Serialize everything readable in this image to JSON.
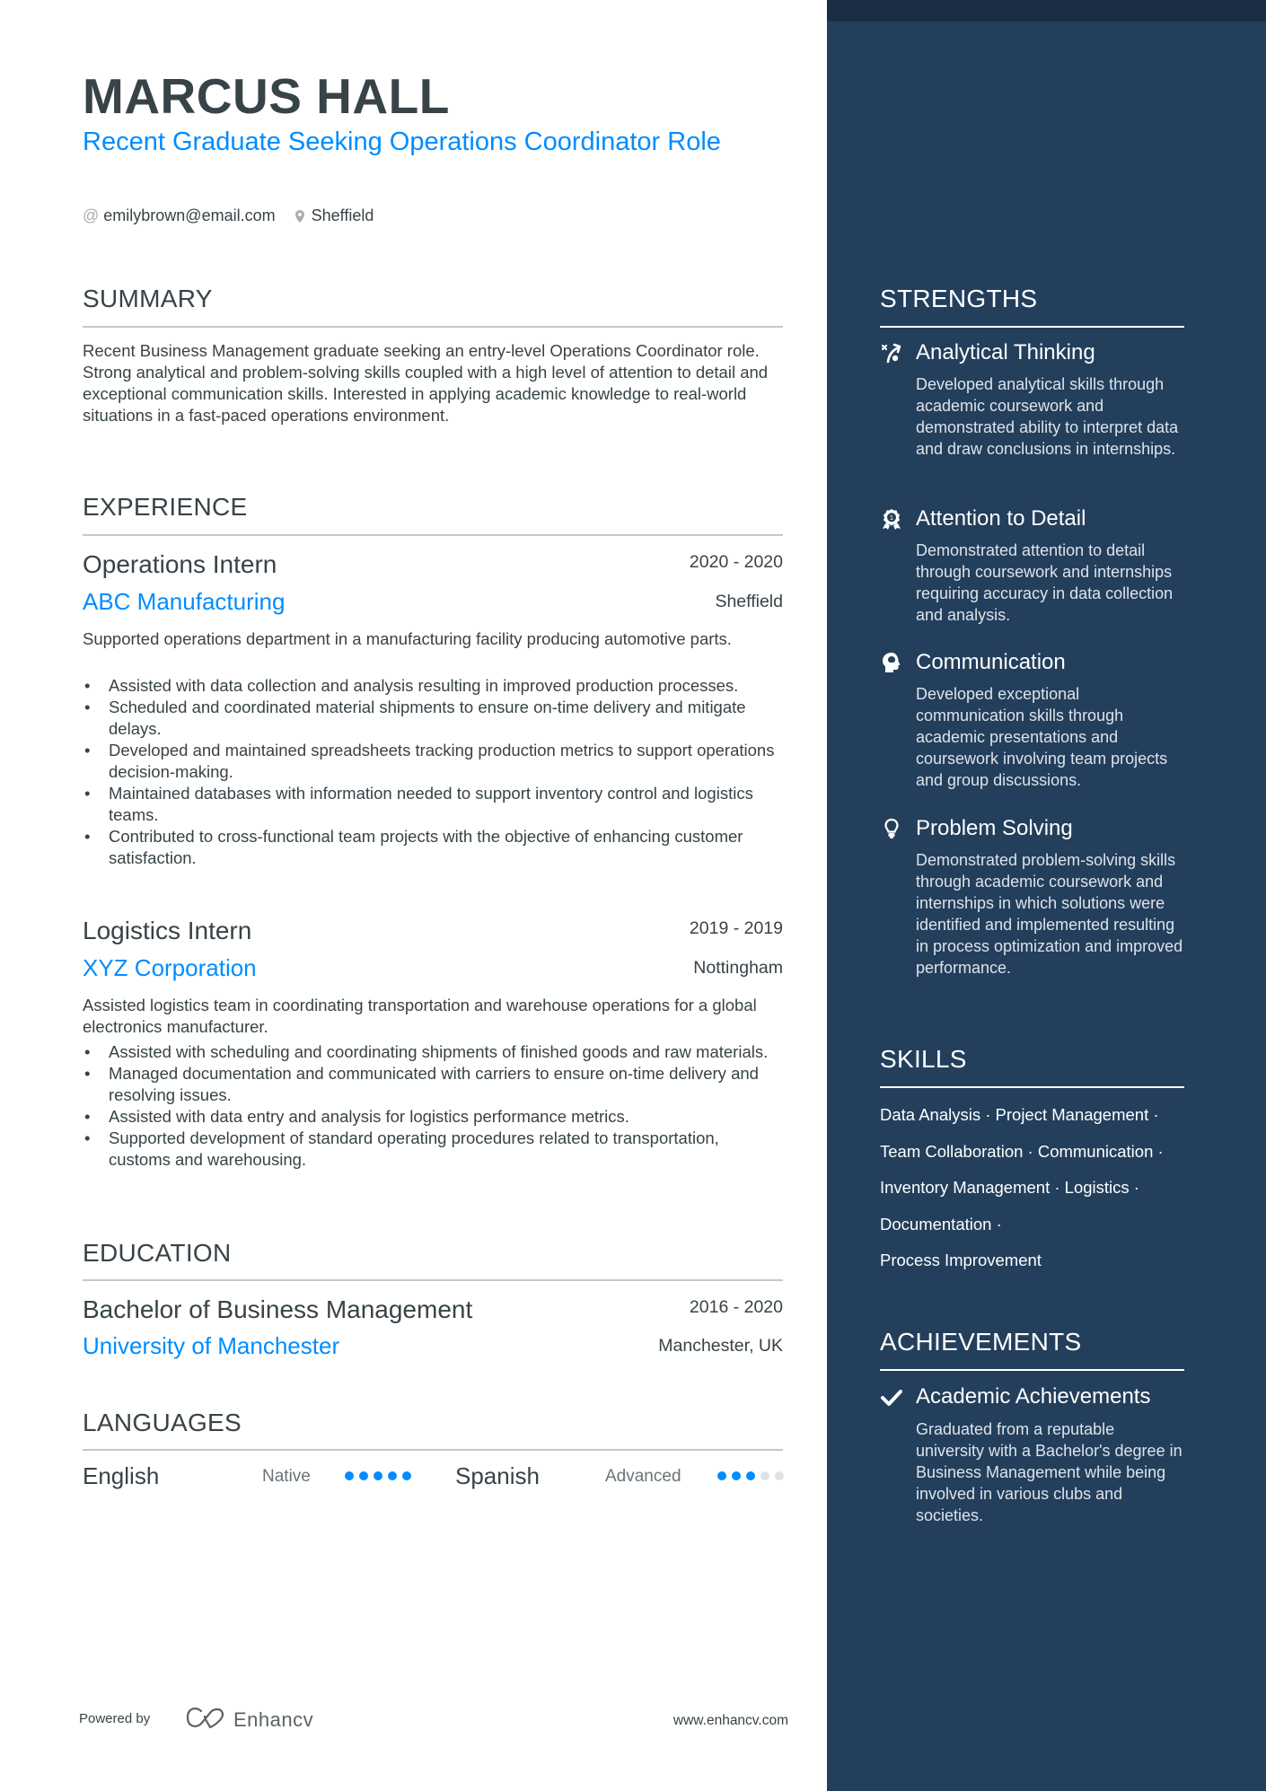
{
  "header": {
    "name": "MARCUS HALL",
    "headline": "Recent Graduate Seeking Operations Coordinator Role",
    "contacts": [
      {
        "icon": "at-icon",
        "text": "emilybrown@email.com"
      },
      {
        "icon": "location-pin-icon",
        "text": "Sheffield"
      }
    ]
  },
  "summary": {
    "title": "SUMMARY",
    "text": "Recent Business Management graduate seeking an entry-level Operations Coordinator role. Strong analytical and problem-solving skills coupled with a high level of attention to detail and exceptional communication skills. Interested in applying academic knowledge to real-world situations in a fast-paced operations environment."
  },
  "experience": {
    "title": "EXPERIENCE",
    "items": [
      {
        "role": "Operations Intern",
        "dates": "2020 - 2020",
        "company": "ABC Manufacturing",
        "location": "Sheffield",
        "description": "Supported operations department in a manufacturing facility producing automotive parts.",
        "bullets": [
          "Assisted with data collection and analysis resulting in improved production processes.",
          "Scheduled and coordinated material shipments to ensure on-time delivery and mitigate delays.",
          "Developed and maintained spreadsheets tracking production metrics to support operations decision-making.",
          "Maintained databases with information needed to support inventory control and logistics teams.",
          "Contributed to cross-functional team projects with the objective of enhancing customer satisfaction."
        ]
      },
      {
        "role": "Logistics Intern",
        "dates": "2019 - 2019",
        "company": "XYZ Corporation",
        "location": "Nottingham",
        "description": "Assisted logistics team in coordinating transportation and warehouse operations for a global electronics manufacturer.",
        "bullets": [
          "Assisted with scheduling and coordinating shipments of finished goods and raw materials.",
          "Managed documentation and communicated with carriers to ensure on-time delivery and resolving issues.",
          "Assisted with data entry and analysis for logistics performance metrics.",
          "Supported development of standard operating procedures related to transportation, customs and warehousing."
        ]
      }
    ]
  },
  "education": {
    "title": "EDUCATION",
    "items": [
      {
        "degree": "Bachelor of Business Management",
        "dates": "2016 - 2020",
        "school": "University of Manchester",
        "location": "Manchester, UK"
      }
    ]
  },
  "languages": {
    "title": "LANGUAGES",
    "items": [
      {
        "name": "English",
        "level": "Native",
        "rating": 5,
        "max": 5
      },
      {
        "name": "Spanish",
        "level": "Advanced",
        "rating": 3,
        "max": 5
      }
    ]
  },
  "footer": {
    "powered_by": "Powered by",
    "brand": "Enhancv",
    "website": "www.enhancv.com"
  },
  "strengths": {
    "title": "STRENGTHS",
    "items": [
      {
        "icon": "analytics-strategy-icon",
        "title": "Analytical Thinking",
        "description": "Developed analytical skills through academic coursework and demonstrated ability to interpret data and draw conclusions in internships."
      },
      {
        "icon": "award-medal-icon",
        "title": "Attention to Detail",
        "description": "Demonstrated attention to detail through coursework and internships requiring accuracy in data collection and analysis."
      },
      {
        "icon": "head-brain-icon",
        "title": "Communication",
        "description": "Developed exceptional communication skills through academic presentations and coursework involving team projects and group discussions."
      },
      {
        "icon": "lightbulb-icon",
        "title": "Problem Solving",
        "description": "Demonstrated problem-solving skills through academic coursework and internships in which solutions were identified and implemented resulting in process optimization and improved performance."
      }
    ]
  },
  "skills": {
    "title": "SKILLS",
    "lines": [
      "Data Analysis · Project Management ·",
      "Team Collaboration · Communication ·",
      "Inventory Management · Logistics ·",
      "Documentation ·",
      "Process Improvement"
    ]
  },
  "achievements": {
    "title": "ACHIEVEMENTS",
    "items": [
      {
        "icon": "checkmark-icon",
        "title": "Academic Achievements",
        "description": "Graduated from a reputable university with a Bachelor's degree in Business Management while being involved in various clubs and societies."
      }
    ]
  },
  "colors": {
    "accent": "#008cff",
    "text": "#384347",
    "sidebar": "#233f5c",
    "sidebar_band": "#1a2d44",
    "dot_off": "#dfe2e4"
  }
}
